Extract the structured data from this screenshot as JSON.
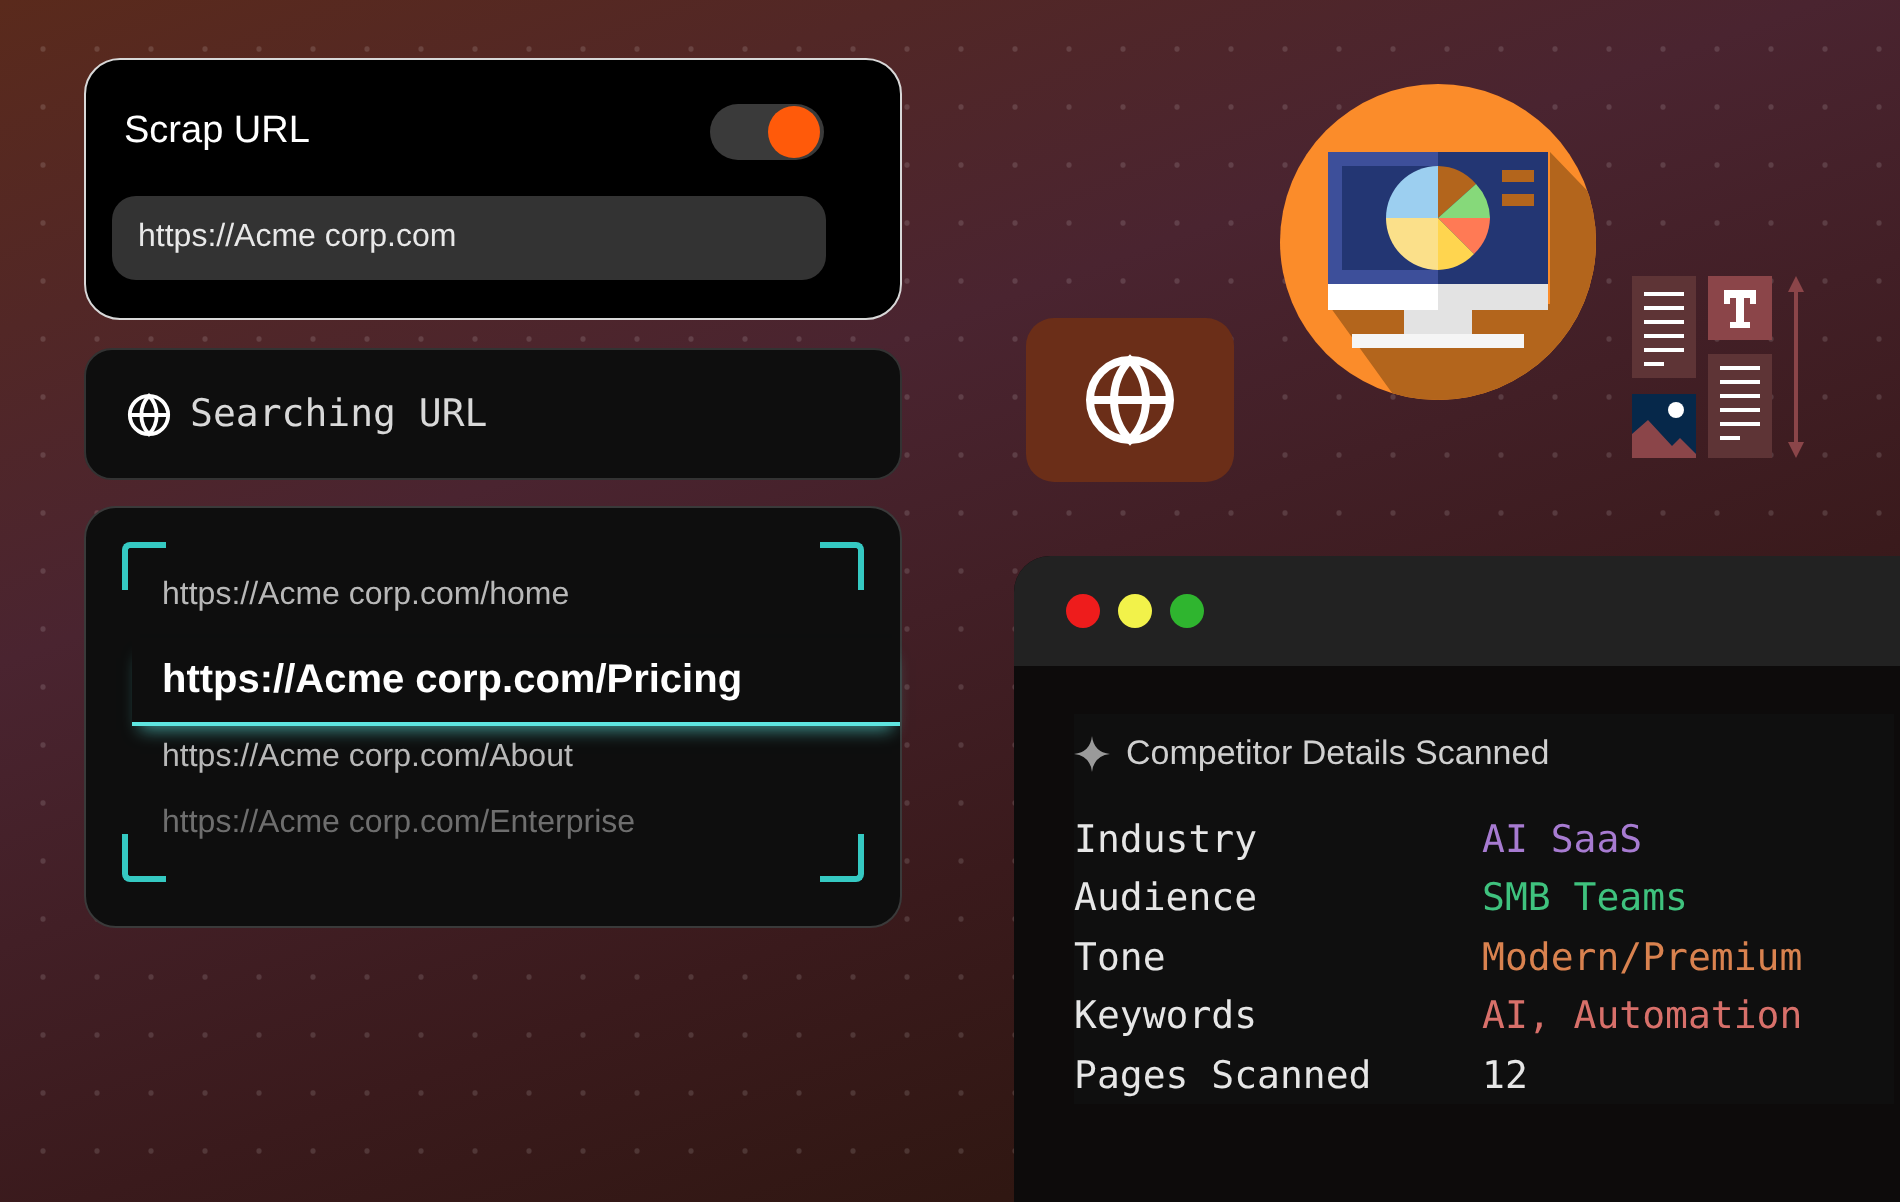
{
  "scrap_card": {
    "title": "Scrap URL",
    "toggle": {
      "on": true
    },
    "url_field": {
      "value": "https://Acme corp.com"
    }
  },
  "status_card": {
    "label": "Searching URL"
  },
  "url_list": [
    {
      "text": "https://Acme corp.com/home",
      "selected": false,
      "dimmed": false
    },
    {
      "text": "https://Acme corp.com/Pricing",
      "selected": true,
      "dimmed": false
    },
    {
      "text": "https://Acme corp.com/About",
      "selected": false,
      "dimmed": false
    },
    {
      "text": "https://Acme corp.com/Enterprise",
      "selected": false,
      "dimmed": true
    }
  ],
  "terminal": {
    "heading": "Competitor Details Scanned",
    "rows": [
      {
        "label": "Industry",
        "value": "AI SaaS",
        "color": "#a77bd1"
      },
      {
        "label": "Audience",
        "value": "SMB Teams",
        "color": "#3fc27e"
      },
      {
        "label": "Tone",
        "value": "Modern/Premium",
        "color": "#d9824f"
      },
      {
        "label": "Keywords",
        "value": "AI, Automation",
        "color": "#d8706a"
      },
      {
        "label": "Pages Scanned",
        "value": "12",
        "color": "#e6e6e6"
      }
    ]
  }
}
